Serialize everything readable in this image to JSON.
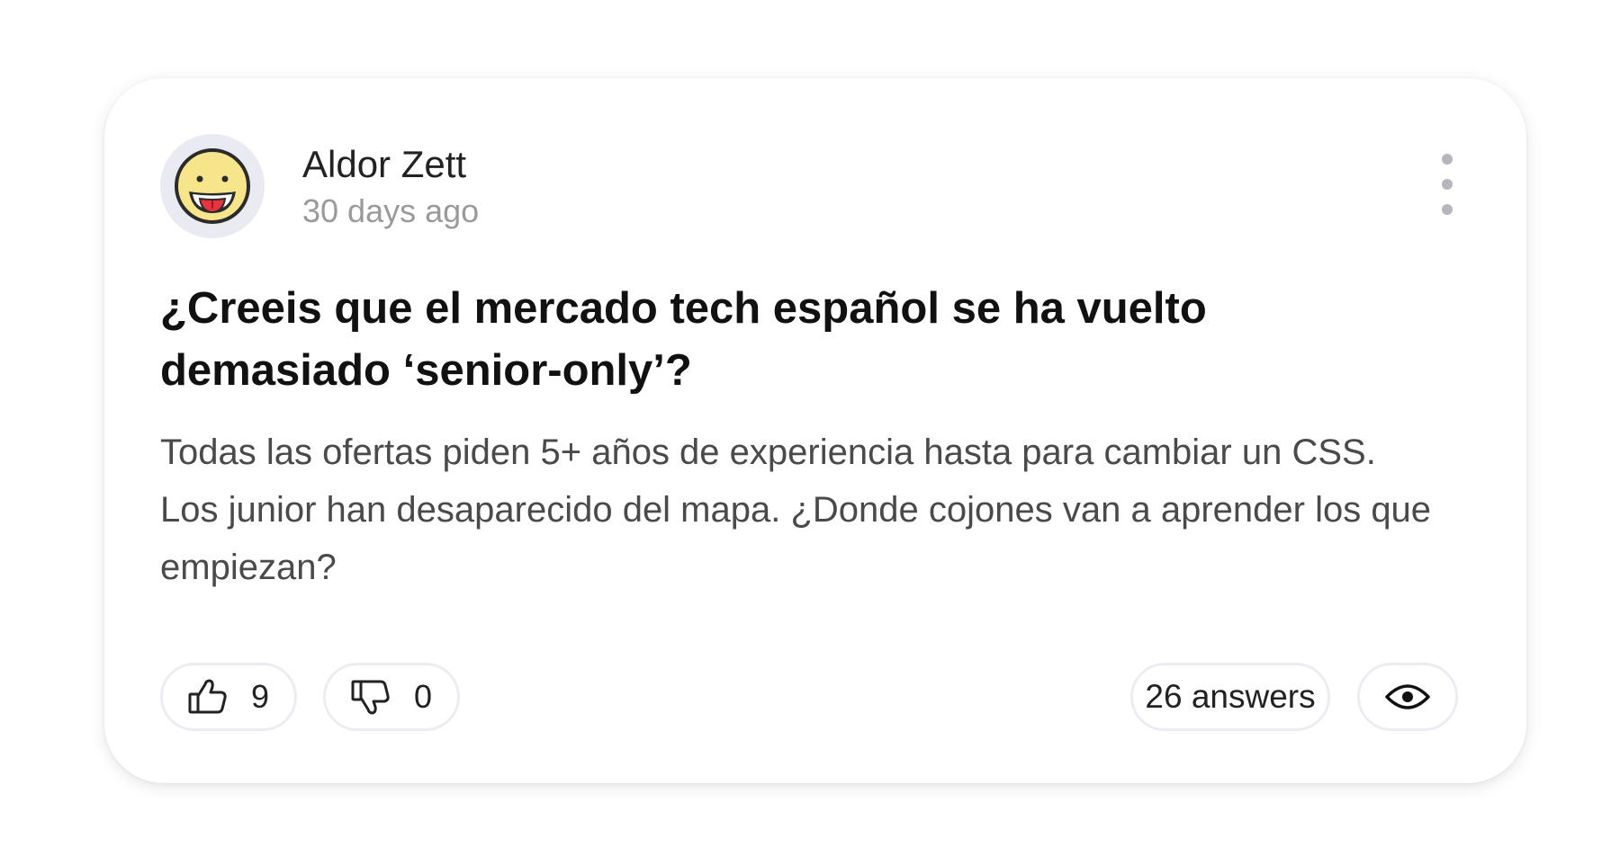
{
  "post": {
    "author": {
      "name": "Aldor Zett",
      "time": "30 days ago",
      "avatar_icon": "tongue-out-emoji-icon"
    },
    "title": "¿Creeis que el mercado tech español se ha vuelto demasiado ‘senior-only’?",
    "body": "Todas las ofertas piden 5+ años de experiencia hasta para cambiar un CSS. Los junior han desaparecido del mapa. ¿Donde cojones van a aprender los que empiezan?",
    "actions": {
      "likes": "9",
      "dislikes": "0",
      "answers_label": "26 answers",
      "like_icon": "thumbs-up-icon",
      "dislike_icon": "thumbs-down-icon",
      "view_icon": "eye-icon",
      "menu_icon": "kebab-menu-icon"
    }
  },
  "colors": {
    "avatar_bg": "#eaeaf2",
    "emoji_face": "#f7e58c",
    "emoji_tongue": "#e8343f",
    "muted_text": "#9a9a9a",
    "body_text": "#4a4a4a",
    "pill_border": "#ececf3"
  }
}
